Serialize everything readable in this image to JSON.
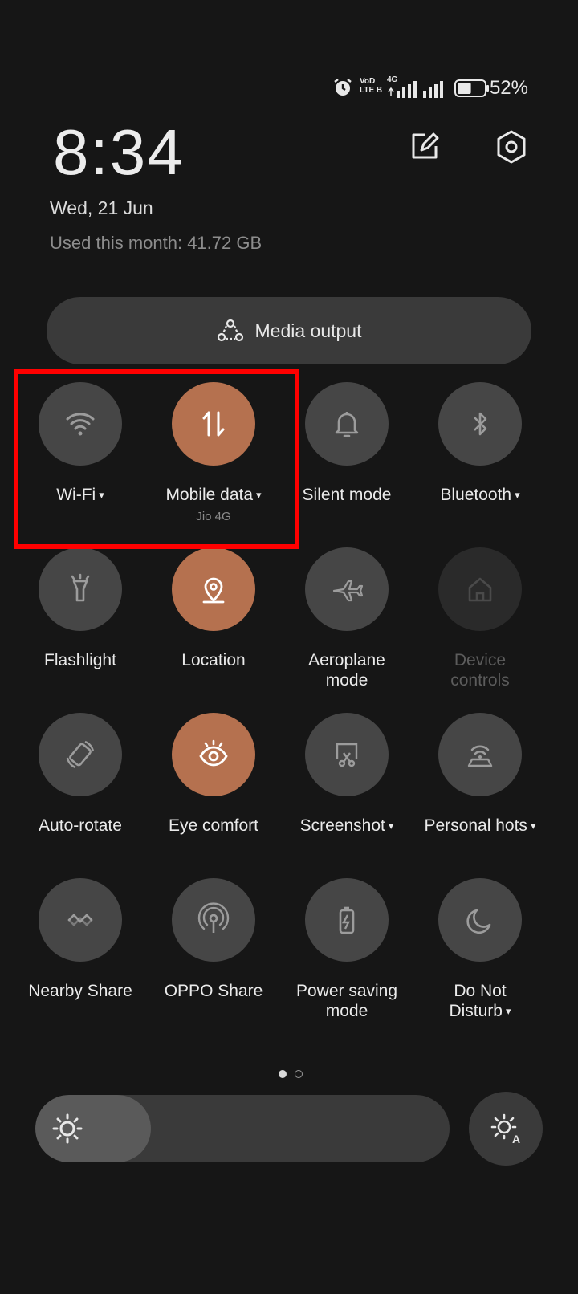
{
  "status_bar": {
    "battery_percent": "52%",
    "network_label_top": "VoD",
    "network_label_bottom": "LTE B",
    "network_type": "4G",
    "battery_level": 0.52
  },
  "header": {
    "time": "8:34",
    "date": "Wed, 21 Jun",
    "data_usage": "Used this month: 41.72 GB"
  },
  "media_output": {
    "label": "Media output"
  },
  "tiles": [
    {
      "label": "Wi-Fi",
      "sub": "",
      "state": "off",
      "caret": true,
      "icon": "wifi-icon"
    },
    {
      "label": "Mobile data",
      "sub": "Jio 4G",
      "state": "on",
      "caret": true,
      "icon": "mobile-data-icon"
    },
    {
      "label": "Silent mode",
      "sub": "",
      "state": "off",
      "caret": false,
      "icon": "bell-icon"
    },
    {
      "label": "Bluetooth",
      "sub": "",
      "state": "off",
      "caret": true,
      "icon": "bluetooth-icon"
    },
    {
      "label": "Flashlight",
      "sub": "",
      "state": "off",
      "caret": false,
      "icon": "flashlight-icon"
    },
    {
      "label": "Location",
      "sub": "",
      "state": "on",
      "caret": false,
      "icon": "location-icon"
    },
    {
      "label": "Aeroplane mode",
      "sub": "",
      "state": "off",
      "caret": false,
      "icon": "airplane-icon"
    },
    {
      "label": "Device controls",
      "sub": "",
      "state": "disabled",
      "caret": false,
      "icon": "home-icon"
    },
    {
      "label": "Auto-rotate",
      "sub": "",
      "state": "off",
      "caret": false,
      "icon": "auto-rotate-icon"
    },
    {
      "label": "Eye comfort",
      "sub": "",
      "state": "on",
      "caret": false,
      "icon": "eye-icon"
    },
    {
      "label": "Screenshot",
      "sub": "",
      "state": "off",
      "caret": true,
      "icon": "screenshot-icon"
    },
    {
      "label": "Personal hots",
      "sub": "",
      "state": "off",
      "caret": true,
      "icon": "hotspot-icon"
    },
    {
      "label": "Nearby Share",
      "sub": "",
      "state": "off",
      "caret": false,
      "icon": "nearby-share-icon"
    },
    {
      "label": "OPPO Share",
      "sub": "",
      "state": "off",
      "caret": false,
      "icon": "oppo-share-icon"
    },
    {
      "label": "Power saving mode",
      "sub": "",
      "state": "off",
      "caret": false,
      "icon": "battery-saver-icon"
    },
    {
      "label": "Do Not Disturb",
      "sub": "",
      "state": "off",
      "caret": true,
      "icon": "moon-icon"
    }
  ],
  "pagination": {
    "pages": 2,
    "current": 1
  },
  "brightness": {
    "level": 0.28
  },
  "colors": {
    "tile_on": "#b5714f",
    "tile_off": "#464646",
    "highlight": "#ff0000",
    "background": "#161616"
  }
}
